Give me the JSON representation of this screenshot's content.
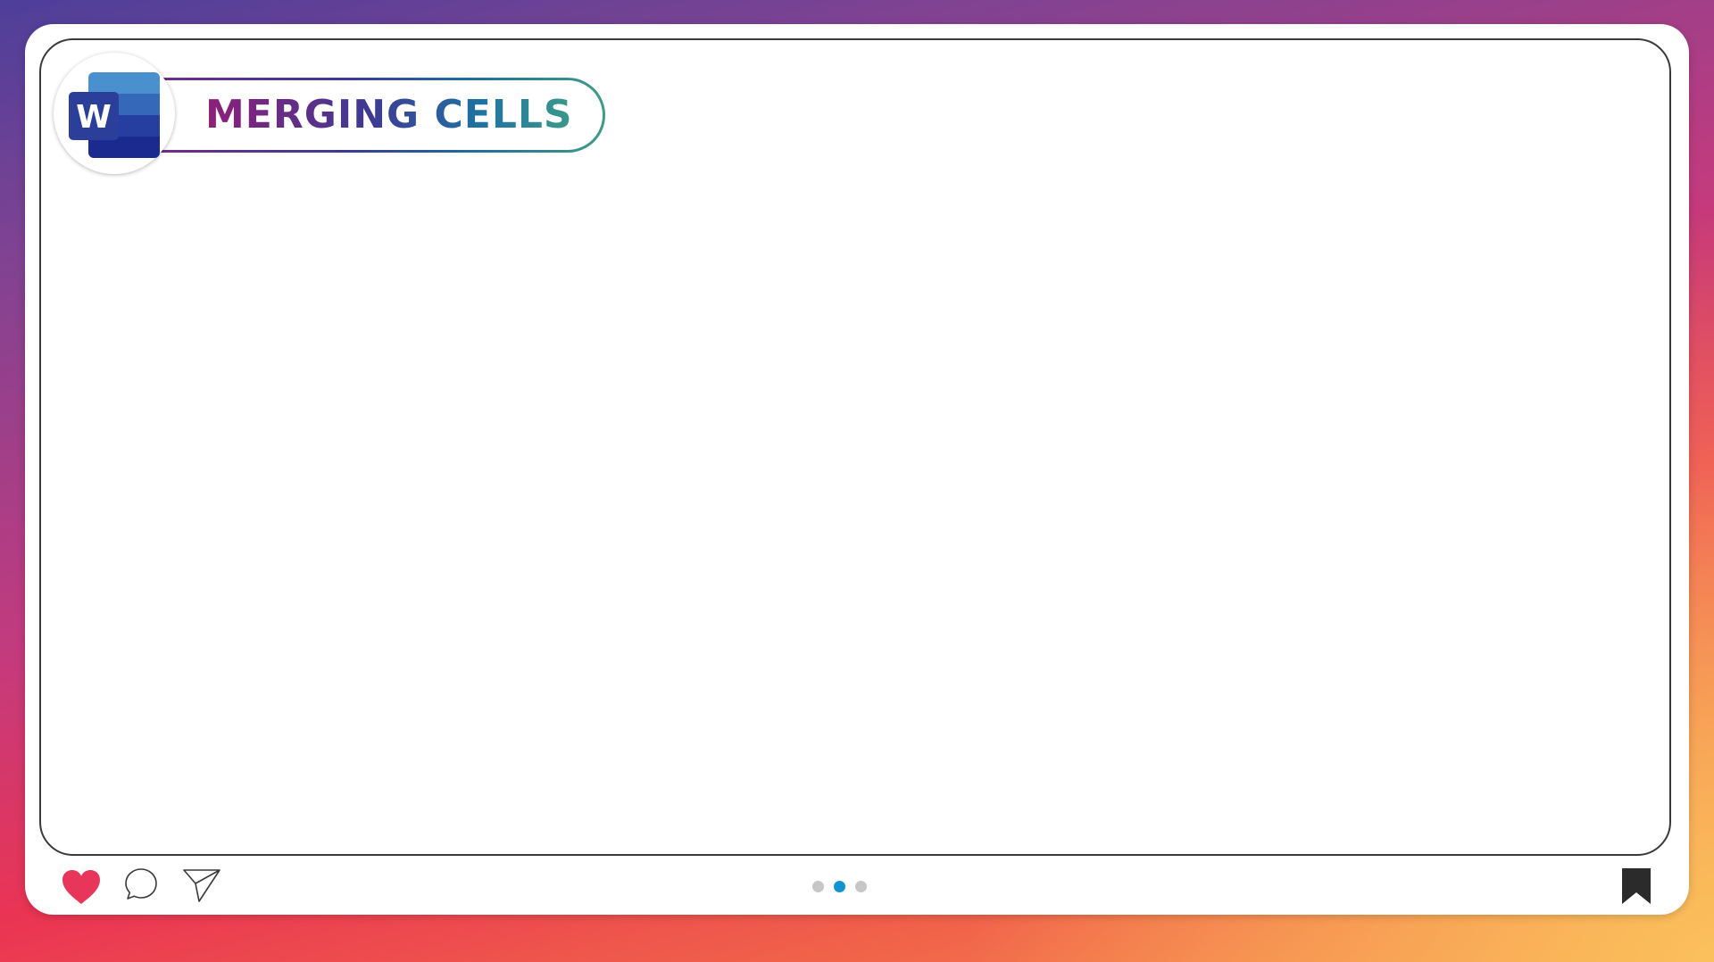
{
  "slide": {
    "title": "MERGING CELLS",
    "app_icon": "microsoft-word-icon",
    "app_icon_letter": "W"
  },
  "footer": {
    "icons": [
      "heart-icon",
      "comment-icon",
      "send-icon",
      "bookmark-icon"
    ],
    "pager": {
      "total": 3,
      "active_index": 1
    }
  },
  "colors": {
    "heart": "#e8365a",
    "pager_active": "#1394cf",
    "pager_inactive": "#c7c7c7",
    "word_blue_dark": "#1b2a8e",
    "word_blue_light": "#4a90cf",
    "title_start": "#8e1f78",
    "title_end": "#3a9a8a"
  }
}
